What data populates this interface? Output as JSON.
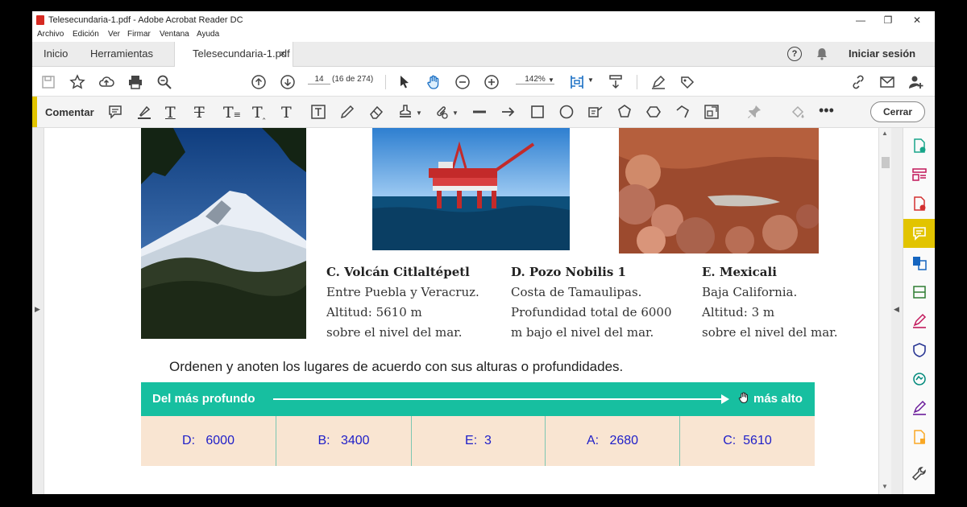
{
  "window": {
    "title": "Telesecundaria-1.pdf - Adobe Acrobat Reader DC",
    "minimize": "—",
    "restore": "❐",
    "close": "✕"
  },
  "menu": [
    "Archivo",
    "Edición",
    "Ver",
    "Firmar",
    "Ventana",
    "Ayuda"
  ],
  "tabs": {
    "home": "Inicio",
    "tools": "Herramientas",
    "document": "Telesecundaria-1.pdf",
    "close_glyph": "×",
    "help_glyph": "?",
    "sign_in": "Iniciar sesión"
  },
  "toolbar": {
    "page_number": "14",
    "page_of": "(16 de 274)",
    "zoom": "142%"
  },
  "comment_bar": {
    "label": "Comentar",
    "close_button": "Cerrar",
    "accent_color": "#e2c400"
  },
  "captions": [
    {
      "title": "C. Volcán Citlaltépetl",
      "lines": [
        "Entre Puebla y Veracruz.",
        "Altitud: 5610 m",
        "sobre el nivel del mar."
      ]
    },
    {
      "title": "D. Pozo Nobilis 1",
      "lines": [
        "Costa de Tamaulipas.",
        "Profundidad total de 6000",
        "m bajo el nivel del mar."
      ]
    },
    {
      "title": "E. Mexicali",
      "lines": [
        "Baja California.",
        "Altitud: 3 m",
        "sobre el nivel del mar."
      ]
    }
  ],
  "instruction": "Ordenen y anoten los lugares de acuerdo con sus alturas o profundidades.",
  "order_bar": {
    "left_label": "Del más profundo",
    "right_label": "más alto",
    "color": "#17bfa0"
  },
  "answers": [
    {
      "letter": "D:",
      "value": "6000"
    },
    {
      "letter": "B:",
      "value": "3400"
    },
    {
      "letter": "E:",
      "value": "3"
    },
    {
      "letter": "A:",
      "value": "2680"
    },
    {
      "letter": "C:",
      "value": "5610"
    }
  ]
}
